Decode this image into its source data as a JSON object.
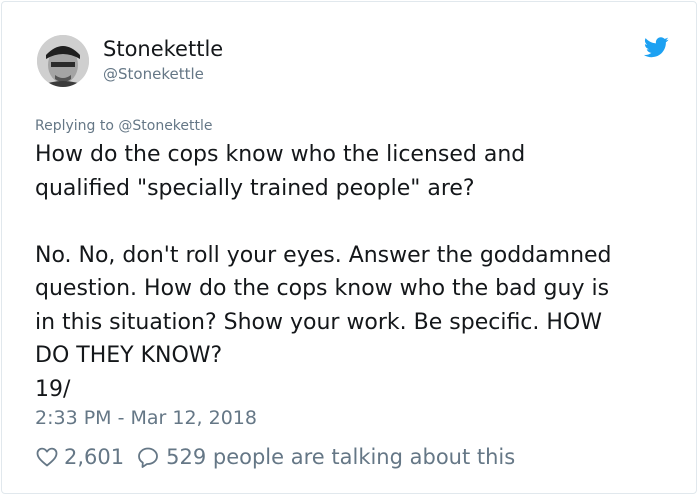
{
  "user": {
    "display_name": "Stonekettle",
    "handle": "@Stonekettle",
    "avatar_icon": "profile-photo"
  },
  "brand_icon": "twitter-bird-icon",
  "accent_color": "#1da1f2",
  "tweet": {
    "replying_to": "Replying to @Stonekettle",
    "lines": [
      "How do the cops know who the licensed and",
      "qualified \"specially trained people\" are?",
      "",
      "No. No, don't roll your eyes. Answer the goddamned",
      "question. How do the cops know who the bad guy is",
      "in this situation? Show your work. Be specific. HOW",
      "DO THEY KNOW?",
      "19/"
    ],
    "timestamp": "2:33 PM - Mar 12, 2018"
  },
  "stats": {
    "likes": "2,601",
    "talking": "529 people are talking about this"
  }
}
